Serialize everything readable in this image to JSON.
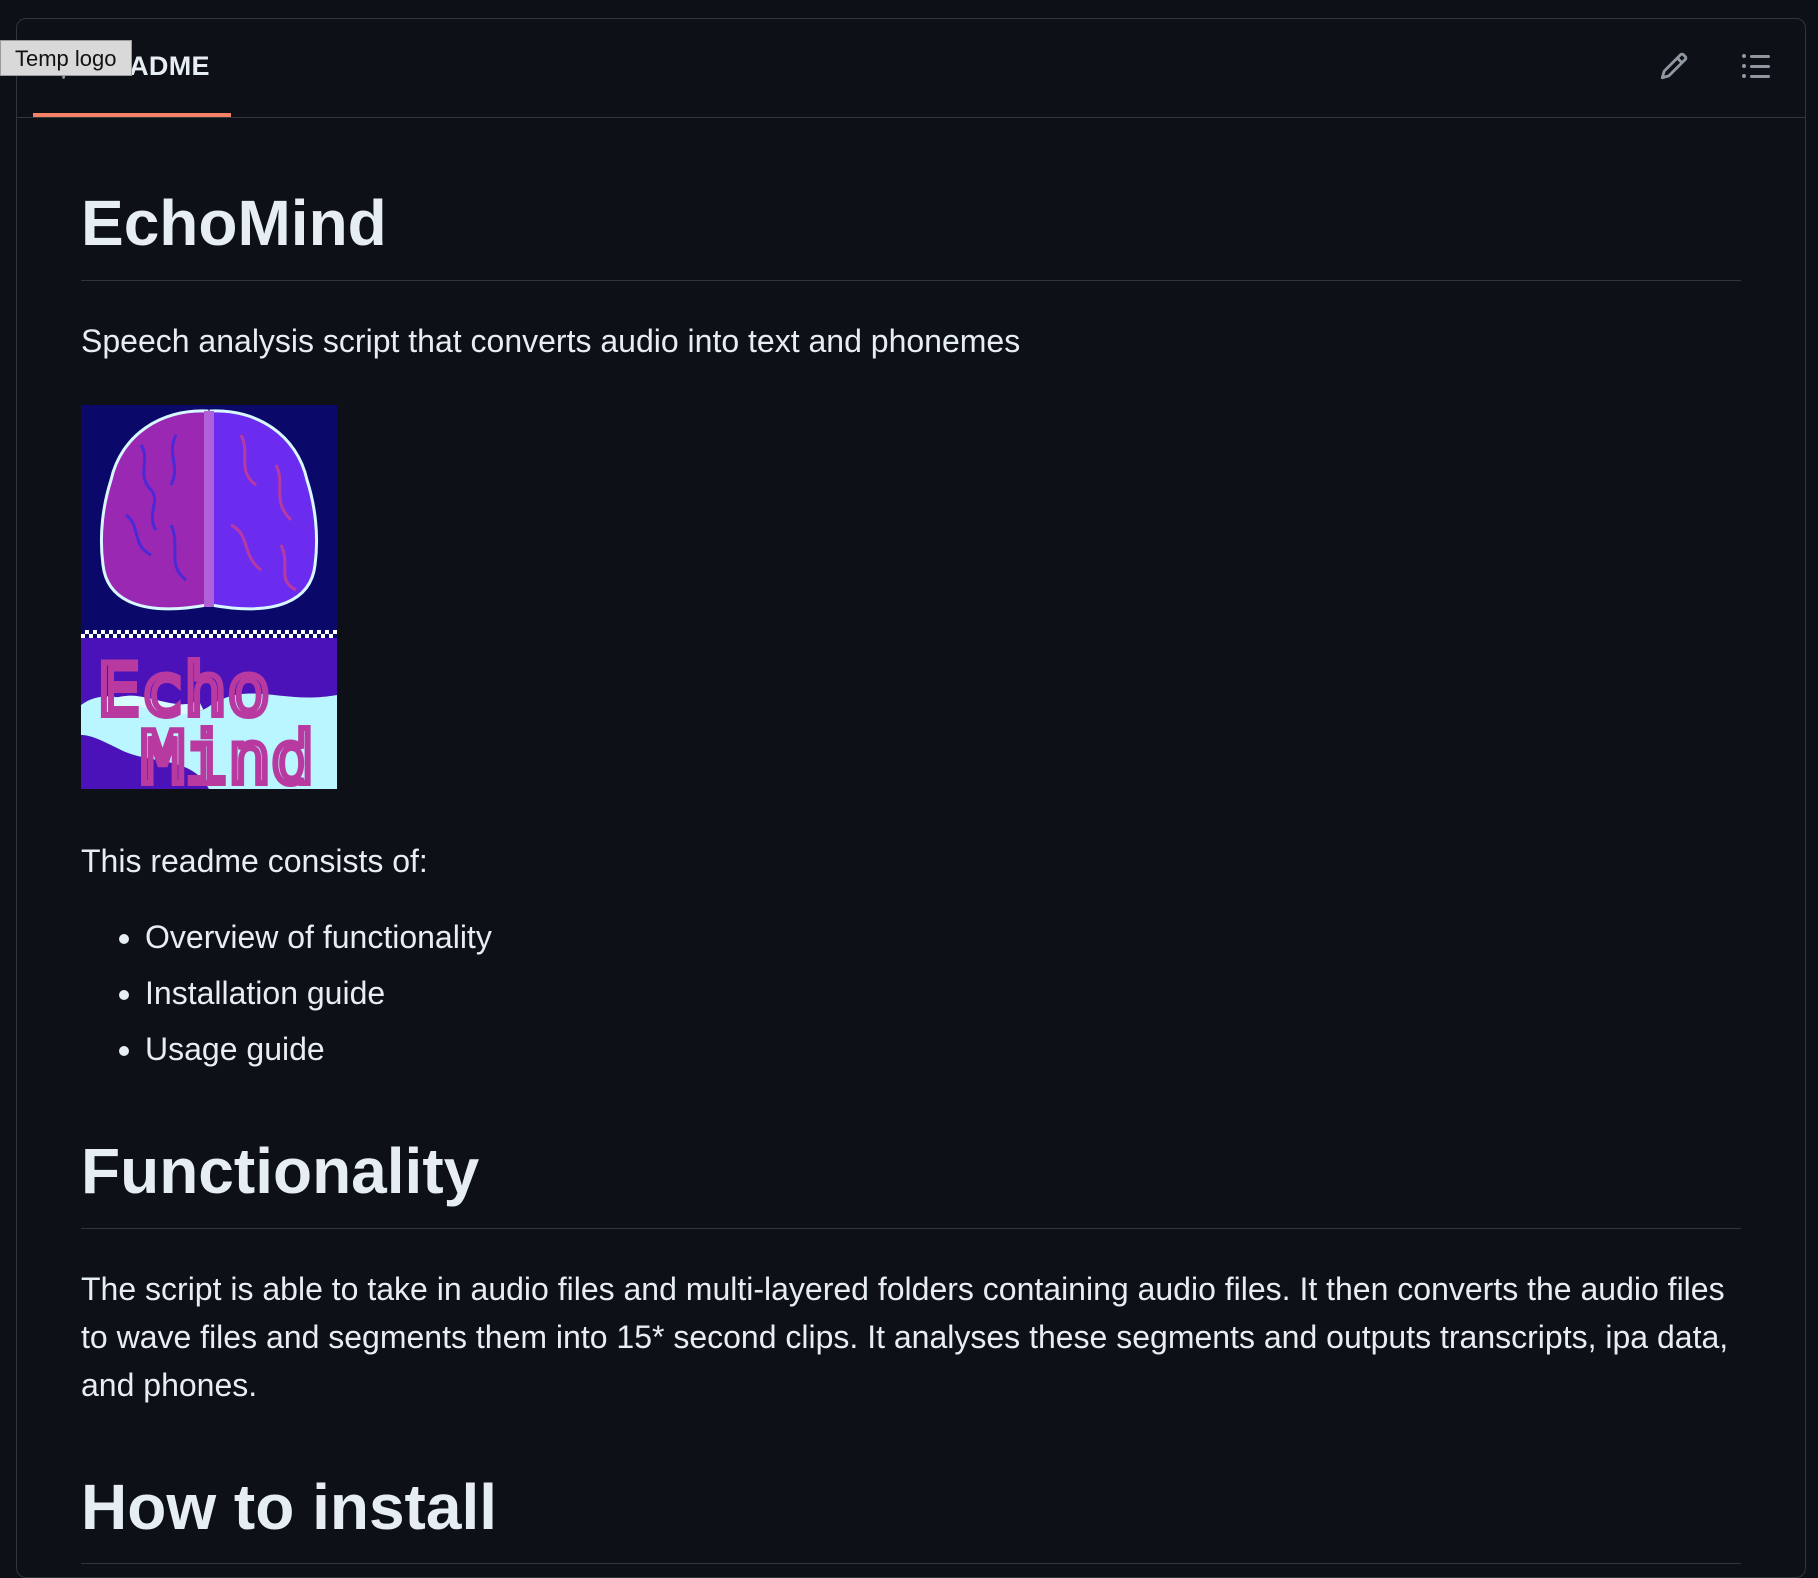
{
  "tooltip": {
    "text": "Temp logo"
  },
  "header": {
    "tab_label": "README",
    "tab_icon": "book-icon",
    "edit_icon": "pencil-icon",
    "outline_icon": "list-icon",
    "accent_color": "#f78166"
  },
  "readme": {
    "title": "EchoMind",
    "description": "Speech analysis script that converts audio into text and phonemes",
    "logo": {
      "alt": "Temp logo",
      "text_line_1": "Echo",
      "text_line_2": "Mind",
      "colors": {
        "bg_top": "#0a0869",
        "brain_left": "#9a28b2",
        "brain_right": "#6b2cf0",
        "bottom": "#4a12b8",
        "wave": "#b9f6ff"
      }
    },
    "intro": "This readme consists of:",
    "toc": [
      "Overview of functionality",
      "Installation guide",
      "Usage guide"
    ],
    "functionality_heading": "Functionality",
    "functionality_text": "The script is able to take in audio files and multi-layered folders containing audio files. It then converts the audio files to wave files and segments them into 15* second clips. It analyses these segments and outputs transcripts, ipa data, and phones.",
    "install_heading": "How to install"
  }
}
